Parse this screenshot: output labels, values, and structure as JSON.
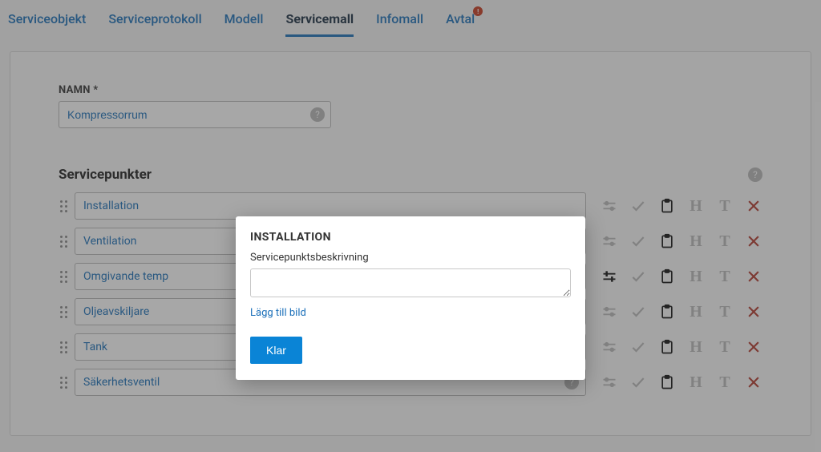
{
  "tabs": [
    {
      "label": "Serviceobjekt",
      "active": false,
      "badge": null
    },
    {
      "label": "Serviceprotokoll",
      "active": false,
      "badge": null
    },
    {
      "label": "Modell",
      "active": false,
      "badge": null
    },
    {
      "label": "Servicemall",
      "active": true,
      "badge": null
    },
    {
      "label": "Infomall",
      "active": false,
      "badge": null
    },
    {
      "label": "Avtal",
      "active": false,
      "badge": "!"
    }
  ],
  "form": {
    "name_label": "NAMN *",
    "name_value": "Kompressorrum"
  },
  "section": {
    "title": "Servicepunkter"
  },
  "servicepoints": [
    {
      "name": "Installation",
      "help": false,
      "highlight_slider": false
    },
    {
      "name": "Ventilation",
      "help": false,
      "highlight_slider": false
    },
    {
      "name": "Omgivande temp",
      "help": false,
      "highlight_slider": true
    },
    {
      "name": "Oljeavskiljare",
      "help": false,
      "highlight_slider": false
    },
    {
      "name": "Tank",
      "help": true,
      "highlight_slider": false
    },
    {
      "name": "Säkerhetsventil",
      "help": true,
      "highlight_slider": false
    }
  ],
  "modal": {
    "title": "INSTALLATION",
    "desc_label": "Servicepunktsbeskrivning",
    "desc_value": "",
    "add_image": "Lägg till bild",
    "done": "Klar"
  },
  "icons": {
    "help": "?"
  }
}
